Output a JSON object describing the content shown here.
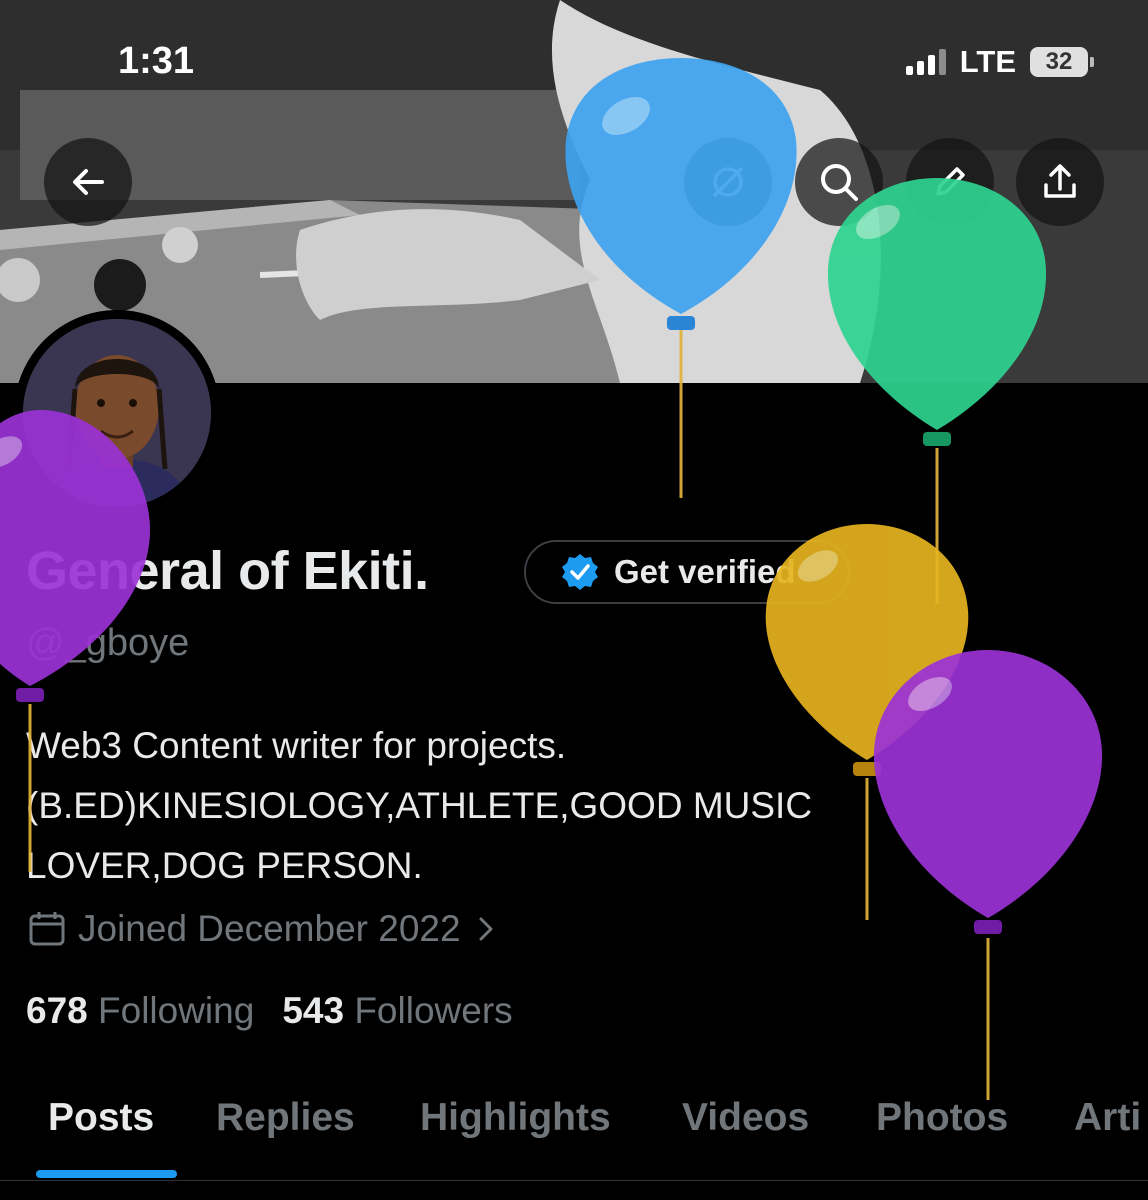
{
  "status_bar": {
    "time": "1:31",
    "network": "LTE",
    "battery": "32"
  },
  "header": {
    "back_icon": "arrow-left-icon",
    "grok_icon": "slash-circle-icon",
    "search_icon": "search-icon",
    "edit_icon": "pencil-icon",
    "share_icon": "share-icon"
  },
  "profile": {
    "name": "General of Ekiti.",
    "verify_button": "Get verified",
    "handle": "@_gboye",
    "bio_lines": [
      "Web3 Content writer for projects.",
      "(B.ED)KINESIOLOGY,ATHLETE,GOOD MUSIC",
      "LOVER,DOG PERSON."
    ],
    "joined": "Joined December 2022",
    "following_count": "678",
    "following_label": "Following",
    "followers_count": "543",
    "followers_label": "Followers"
  },
  "tabs": [
    "Posts",
    "Replies",
    "Highlights",
    "Videos",
    "Photos",
    "Arti"
  ],
  "colors": {
    "accent": "#1d9bf0",
    "background": "#000000",
    "muted": "#71767b"
  }
}
